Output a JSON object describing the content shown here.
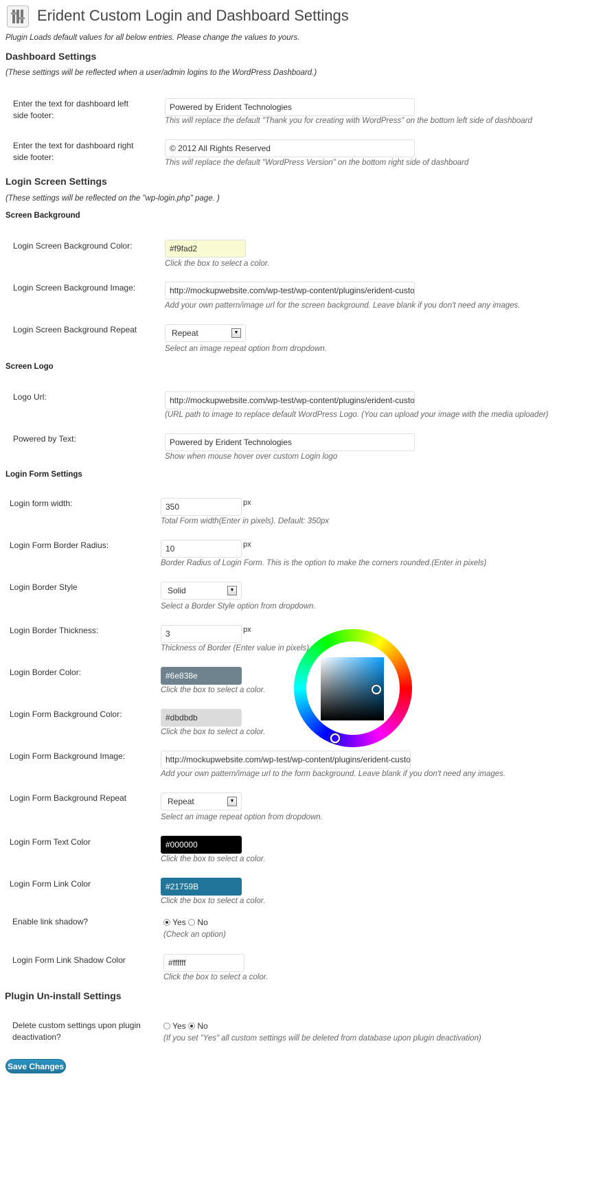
{
  "page": {
    "title": "Erident Custom Login and Dashboard Settings",
    "intro": "Plugin Loads default values for all below entries. Please change the values to yours."
  },
  "dashboard": {
    "heading": "Dashboard Settings",
    "note": "(These settings will be reflected when a user/admin logins to the WordPress Dashboard.)",
    "left_footer": {
      "label": "Enter the text for dashboard left side footer:",
      "value": "Powered by Erident Technologies",
      "desc": "This will replace the default \"Thank you for creating with WordPress\" on the bottom left side of dashboard"
    },
    "right_footer": {
      "label": "Enter the text for dashboard right side footer:",
      "value": "© 2012 All Rights Reserved",
      "desc": "This will replace the default \"WordPress Version\" on the bottom right side of dashboard"
    }
  },
  "login_screen": {
    "heading": "Login Screen Settings",
    "note": "(These settings will be reflected on the \"wp-login.php\" page. )",
    "background": {
      "heading": "Screen Background",
      "color": {
        "label": "Login Screen Background Color:",
        "value": "#f9fad2",
        "desc": "Click the box to select a color.",
        "swatch": "#f9fad2"
      },
      "image": {
        "label": "Login Screen Background Image:",
        "value": "http://mockupwebsite.com/wp-test/wp-content/plugins/erident-custom-l",
        "desc": "Add your own pattern/image url for the screen background. Leave blank if you don't need any images."
      },
      "repeat": {
        "label": "Login Screen Background Repeat",
        "value": "Repeat",
        "desc": "Select an image repeat option from dropdown."
      }
    },
    "logo": {
      "heading": "Screen Logo",
      "url": {
        "label": "Logo Url:",
        "value": "http://mockupwebsite.com/wp-test/wp-content/plugins/erident-custom-l",
        "desc": "(URL path to image to replace default WordPress Logo. (You can upload your image with the media uploader)"
      },
      "powered": {
        "label": "Powered by Text:",
        "value": "Powered by Erident Technologies",
        "desc": "Show when mouse hover over custom Login logo"
      }
    }
  },
  "login_form": {
    "heading": "Login Form Settings",
    "unit": "px",
    "width": {
      "label": "Login form width:",
      "value": "350",
      "desc": "Total Form width(Enter in pixels). Default: 350px"
    },
    "radius": {
      "label": "Login Form Border Radius:",
      "value": "10",
      "desc": "Border Radius of Login Form. This is the option to make the corners rounded.(Enter in pixels)"
    },
    "border_style": {
      "label": "Login Border Style",
      "value": "Solid",
      "desc": "Select a Border Style option from dropdown."
    },
    "border_thickness": {
      "label": "Login Border Thickness:",
      "value": "3",
      "desc": "Thickness of Border (Enter value in pixels)"
    },
    "border_color": {
      "label": "Login Border Color:",
      "value": "#6e838e",
      "desc": "Click the box to select a color.",
      "swatch": "#6e838e"
    },
    "bg_color": {
      "label": "Login Form Background Color:",
      "value": "#dbdbdb",
      "desc": "Click the box to select a color.",
      "swatch": "#dbdbdb"
    },
    "bg_image": {
      "label": "Login Form Background Image:",
      "value": "http://mockupwebsite.com/wp-test/wp-content/plugins/erident-custom-l",
      "desc": "Add your own pattern/image url to the form background. Leave blank if you don't need any images."
    },
    "bg_repeat": {
      "label": "Login Form Background Repeat",
      "value": "Repeat",
      "desc": "Select an image repeat option from dropdown."
    },
    "text_color": {
      "label": "Login Form Text Color",
      "value": "#000000",
      "desc": "Click the box to select a color.",
      "swatch": "#000000"
    },
    "link_color": {
      "label": "Login Form Link Color",
      "value": "#21759B",
      "desc": "Click the box to select a color.",
      "swatch": "#21759b"
    },
    "link_shadow": {
      "label": "Enable link shadow?",
      "yes": "Yes",
      "no": "No",
      "selected": "Yes",
      "desc": "(Check an option)"
    },
    "shadow_color": {
      "label": "Login Form Link Shadow Color",
      "value": "#ffffff",
      "desc": "Click the box to select a color."
    }
  },
  "uninstall": {
    "heading": "Plugin Un-install Settings",
    "label": "Delete custom settings upon plugin deactivation?",
    "yes": "Yes",
    "no": "No",
    "selected": "No",
    "desc": "(If you set \"Yes\" all custom settings will be deleted from database upon plugin deactivation)"
  },
  "save_label": "Save Changes"
}
